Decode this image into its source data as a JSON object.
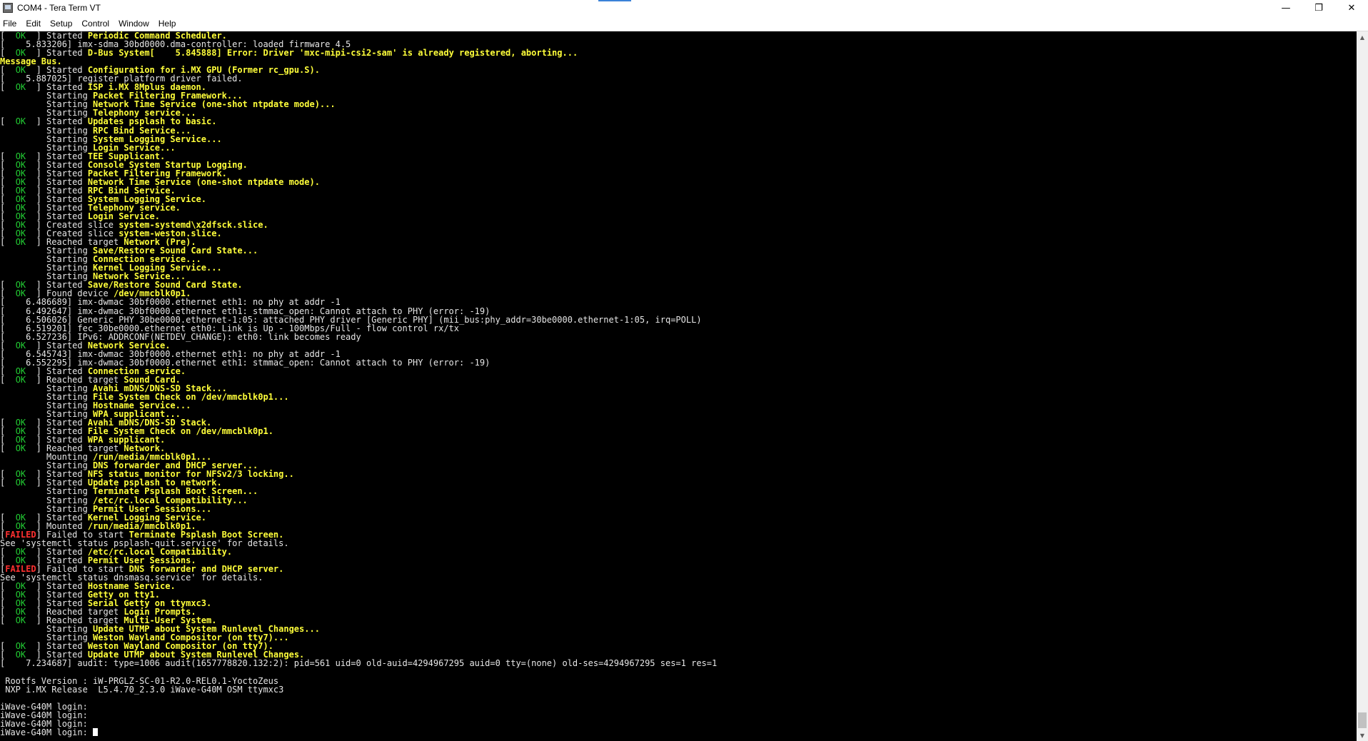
{
  "window": {
    "title": "COM4 - Tera Term VT",
    "minimize_glyph": "—",
    "restore_glyph": "❐",
    "close_glyph": "✕"
  },
  "menu": [
    "File",
    "Edit",
    "Setup",
    "Control",
    "Window",
    "Help"
  ],
  "colors": {
    "background": "#000000",
    "default": "#e6e6e6",
    "ok": "#22cc33",
    "highlight": "#ffff3a",
    "failed": "#ff3030"
  },
  "terminal": {
    "lines": [
      [
        [
          "w",
          "[  "
        ],
        [
          "g",
          "OK"
        ],
        [
          "w",
          "  ] Started "
        ],
        [
          "y",
          "Periodic Command Scheduler."
        ]
      ],
      [
        [
          "w",
          "[    5.833206] imx-sdma 30bd0000.dma-controller: loaded firmware 4.5"
        ]
      ],
      [
        [
          "w",
          "[  "
        ],
        [
          "g",
          "OK"
        ],
        [
          "w",
          "  ] Started "
        ],
        [
          "y",
          "D-Bus System[    5.845888] Error: Driver 'mxc-mipi-csi2-sam' is already registered, aborting..."
        ]
      ],
      [
        [
          "y",
          "Message Bus."
        ]
      ],
      [
        [
          "w",
          "[  "
        ],
        [
          "g",
          "OK"
        ],
        [
          "w",
          "  ] Started "
        ],
        [
          "y",
          "Configuration for i.MX GPU (Former rc_gpu.S)."
        ]
      ],
      [
        [
          "w",
          "[    5.887025] register platform driver failed."
        ]
      ],
      [
        [
          "w",
          "[  "
        ],
        [
          "g",
          "OK"
        ],
        [
          "w",
          "  ] Started "
        ],
        [
          "y",
          "ISP i.MX 8Mplus daemon."
        ]
      ],
      [
        [
          "w",
          "         Starting "
        ],
        [
          "y",
          "Packet Filtering Framework..."
        ]
      ],
      [
        [
          "w",
          "         Starting "
        ],
        [
          "y",
          "Network Time Service (one-shot ntpdate mode)..."
        ]
      ],
      [
        [
          "w",
          "         Starting "
        ],
        [
          "y",
          "Telephony service..."
        ]
      ],
      [
        [
          "w",
          "[  "
        ],
        [
          "g",
          "OK"
        ],
        [
          "w",
          "  ] Started "
        ],
        [
          "y",
          "Updates psplash to basic."
        ]
      ],
      [
        [
          "w",
          "         Starting "
        ],
        [
          "y",
          "RPC Bind Service..."
        ]
      ],
      [
        [
          "w",
          "         Starting "
        ],
        [
          "y",
          "System Logging Service..."
        ]
      ],
      [
        [
          "w",
          "         Starting "
        ],
        [
          "y",
          "Login Service..."
        ]
      ],
      [
        [
          "w",
          "[  "
        ],
        [
          "g",
          "OK"
        ],
        [
          "w",
          "  ] Started "
        ],
        [
          "y",
          "TEE Supplicant."
        ]
      ],
      [
        [
          "w",
          "[  "
        ],
        [
          "g",
          "OK"
        ],
        [
          "w",
          "  ] Started "
        ],
        [
          "y",
          "Console System Startup Logging."
        ]
      ],
      [
        [
          "w",
          "[  "
        ],
        [
          "g",
          "OK"
        ],
        [
          "w",
          "  ] Started "
        ],
        [
          "y",
          "Packet Filtering Framework."
        ]
      ],
      [
        [
          "w",
          "[  "
        ],
        [
          "g",
          "OK"
        ],
        [
          "w",
          "  ] Started "
        ],
        [
          "y",
          "Network Time Service (one-shot ntpdate mode)."
        ]
      ],
      [
        [
          "w",
          "[  "
        ],
        [
          "g",
          "OK"
        ],
        [
          "w",
          "  ] Started "
        ],
        [
          "y",
          "RPC Bind Service."
        ]
      ],
      [
        [
          "w",
          "[  "
        ],
        [
          "g",
          "OK"
        ],
        [
          "w",
          "  ] Started "
        ],
        [
          "y",
          "System Logging Service."
        ]
      ],
      [
        [
          "w",
          "[  "
        ],
        [
          "g",
          "OK"
        ],
        [
          "w",
          "  ] Started "
        ],
        [
          "y",
          "Telephony service."
        ]
      ],
      [
        [
          "w",
          "[  "
        ],
        [
          "g",
          "OK"
        ],
        [
          "w",
          "  ] Started "
        ],
        [
          "y",
          "Login Service."
        ]
      ],
      [
        [
          "w",
          "[  "
        ],
        [
          "g",
          "OK"
        ],
        [
          "w",
          "  ] Created slice "
        ],
        [
          "y",
          "system-systemd\\x2dfsck.slice."
        ]
      ],
      [
        [
          "w",
          "[  "
        ],
        [
          "g",
          "OK"
        ],
        [
          "w",
          "  ] Created slice "
        ],
        [
          "y",
          "system-weston.slice."
        ]
      ],
      [
        [
          "w",
          "[  "
        ],
        [
          "g",
          "OK"
        ],
        [
          "w",
          "  ] Reached target "
        ],
        [
          "y",
          "Network (Pre)."
        ]
      ],
      [
        [
          "w",
          "         Starting "
        ],
        [
          "y",
          "Save/Restore Sound Card State..."
        ]
      ],
      [
        [
          "w",
          "         Starting "
        ],
        [
          "y",
          "Connection service..."
        ]
      ],
      [
        [
          "w",
          "         Starting "
        ],
        [
          "y",
          "Kernel Logging Service..."
        ]
      ],
      [
        [
          "w",
          "         Starting "
        ],
        [
          "y",
          "Network Service..."
        ]
      ],
      [
        [
          "w",
          "[  "
        ],
        [
          "g",
          "OK"
        ],
        [
          "w",
          "  ] Started "
        ],
        [
          "y",
          "Save/Restore Sound Card State."
        ]
      ],
      [
        [
          "w",
          "[  "
        ],
        [
          "g",
          "OK"
        ],
        [
          "w",
          "  ] Found device "
        ],
        [
          "y",
          "/dev/mmcblk0p1."
        ]
      ],
      [
        [
          "w",
          "[    6.486689] imx-dwmac 30bf0000.ethernet eth1: no phy at addr -1"
        ]
      ],
      [
        [
          "w",
          "[    6.492647] imx-dwmac 30bf0000.ethernet eth1: stmmac_open: Cannot attach to PHY (error: -19)"
        ]
      ],
      [
        [
          "w",
          "[    6.506026] Generic PHY 30be0000.ethernet-1:05: attached PHY driver [Generic PHY] (mii_bus:phy_addr=30be0000.ethernet-1:05, irq=POLL)"
        ]
      ],
      [
        [
          "w",
          "[    6.519201] fec 30be0000.ethernet eth0: Link is Up - 100Mbps/Full - flow control rx/tx"
        ]
      ],
      [
        [
          "w",
          "[    6.527236] IPv6: ADDRCONF(NETDEV_CHANGE): eth0: link becomes ready"
        ]
      ],
      [
        [
          "w",
          "[  "
        ],
        [
          "g",
          "OK"
        ],
        [
          "w",
          "  ] Started "
        ],
        [
          "y",
          "Network Service."
        ]
      ],
      [
        [
          "w",
          "[    6.545743] imx-dwmac 30bf0000.ethernet eth1: no phy at addr -1"
        ]
      ],
      [
        [
          "w",
          "[    6.552295] imx-dwmac 30bf0000.ethernet eth1: stmmac_open: Cannot attach to PHY (error: -19)"
        ]
      ],
      [
        [
          "w",
          "[  "
        ],
        [
          "g",
          "OK"
        ],
        [
          "w",
          "  ] Started "
        ],
        [
          "y",
          "Connection service."
        ]
      ],
      [
        [
          "w",
          "[  "
        ],
        [
          "g",
          "OK"
        ],
        [
          "w",
          "  ] Reached target "
        ],
        [
          "y",
          "Sound Card."
        ]
      ],
      [
        [
          "w",
          "         Starting "
        ],
        [
          "y",
          "Avahi mDNS/DNS-SD Stack..."
        ]
      ],
      [
        [
          "w",
          "         Starting "
        ],
        [
          "y",
          "File System Check on /dev/mmcblk0p1..."
        ]
      ],
      [
        [
          "w",
          "         Starting "
        ],
        [
          "y",
          "Hostname Service..."
        ]
      ],
      [
        [
          "w",
          "         Starting "
        ],
        [
          "y",
          "WPA supplicant..."
        ]
      ],
      [
        [
          "w",
          "[  "
        ],
        [
          "g",
          "OK"
        ],
        [
          "w",
          "  ] Started "
        ],
        [
          "y",
          "Avahi mDNS/DNS-SD Stack."
        ]
      ],
      [
        [
          "w",
          "[  "
        ],
        [
          "g",
          "OK"
        ],
        [
          "w",
          "  ] Started "
        ],
        [
          "y",
          "File System Check on /dev/mmcblk0p1."
        ]
      ],
      [
        [
          "w",
          "[  "
        ],
        [
          "g",
          "OK"
        ],
        [
          "w",
          "  ] Started "
        ],
        [
          "y",
          "WPA supplicant."
        ]
      ],
      [
        [
          "w",
          "[  "
        ],
        [
          "g",
          "OK"
        ],
        [
          "w",
          "  ] Reached target "
        ],
        [
          "y",
          "Network."
        ]
      ],
      [
        [
          "w",
          "         Mounting "
        ],
        [
          "y",
          "/run/media/mmcblk0p1..."
        ]
      ],
      [
        [
          "w",
          "         Starting "
        ],
        [
          "y",
          "DNS forwarder and DHCP server..."
        ]
      ],
      [
        [
          "w",
          "[  "
        ],
        [
          "g",
          "OK"
        ],
        [
          "w",
          "  ] Started "
        ],
        [
          "y",
          "NFS status monitor for NFSv2/3 locking.."
        ]
      ],
      [
        [
          "w",
          "[  "
        ],
        [
          "g",
          "OK"
        ],
        [
          "w",
          "  ] Started "
        ],
        [
          "y",
          "Update psplash to network."
        ]
      ],
      [
        [
          "w",
          "         Starting "
        ],
        [
          "y",
          "Terminate Psplash Boot Screen..."
        ]
      ],
      [
        [
          "w",
          "         Starting "
        ],
        [
          "y",
          "/etc/rc.local Compatibility..."
        ]
      ],
      [
        [
          "w",
          "         Starting "
        ],
        [
          "y",
          "Permit User Sessions..."
        ]
      ],
      [
        [
          "w",
          "[  "
        ],
        [
          "g",
          "OK"
        ],
        [
          "w",
          "  ] Started "
        ],
        [
          "y",
          "Kernel Logging Service."
        ]
      ],
      [
        [
          "w",
          "[  "
        ],
        [
          "g",
          "OK"
        ],
        [
          "w",
          "  ] Mounted "
        ],
        [
          "y",
          "/run/media/mmcblk0p1."
        ]
      ],
      [
        [
          "w",
          "["
        ],
        [
          "r",
          "FAILED"
        ],
        [
          "w",
          "] Failed to start "
        ],
        [
          "y",
          "Terminate Psplash Boot Screen."
        ]
      ],
      [
        [
          "w",
          "See 'systemctl status psplash-quit.service' for details."
        ]
      ],
      [
        [
          "w",
          "[  "
        ],
        [
          "g",
          "OK"
        ],
        [
          "w",
          "  ] Started "
        ],
        [
          "y",
          "/etc/rc.local Compatibility."
        ]
      ],
      [
        [
          "w",
          "[  "
        ],
        [
          "g",
          "OK"
        ],
        [
          "w",
          "  ] Started "
        ],
        [
          "y",
          "Permit User Sessions."
        ]
      ],
      [
        [
          "w",
          "["
        ],
        [
          "r",
          "FAILED"
        ],
        [
          "w",
          "] Failed to start "
        ],
        [
          "y",
          "DNS forwarder and DHCP server."
        ]
      ],
      [
        [
          "w",
          "See 'systemctl status dnsmasq.service' for details."
        ]
      ],
      [
        [
          "w",
          "[  "
        ],
        [
          "g",
          "OK"
        ],
        [
          "w",
          "  ] Started "
        ],
        [
          "y",
          "Hostname Service."
        ]
      ],
      [
        [
          "w",
          "[  "
        ],
        [
          "g",
          "OK"
        ],
        [
          "w",
          "  ] Started "
        ],
        [
          "y",
          "Getty on tty1."
        ]
      ],
      [
        [
          "w",
          "[  "
        ],
        [
          "g",
          "OK"
        ],
        [
          "w",
          "  ] Started "
        ],
        [
          "y",
          "Serial Getty on ttymxc3."
        ]
      ],
      [
        [
          "w",
          "[  "
        ],
        [
          "g",
          "OK"
        ],
        [
          "w",
          "  ] Reached target "
        ],
        [
          "y",
          "Login Prompts."
        ]
      ],
      [
        [
          "w",
          "[  "
        ],
        [
          "g",
          "OK"
        ],
        [
          "w",
          "  ] Reached target "
        ],
        [
          "y",
          "Multi-User System."
        ]
      ],
      [
        [
          "w",
          "         Starting "
        ],
        [
          "y",
          "Update UTMP about System Runlevel Changes..."
        ]
      ],
      [
        [
          "w",
          "         Starting "
        ],
        [
          "y",
          "Weston Wayland Compositor (on tty7)..."
        ]
      ],
      [
        [
          "w",
          "[  "
        ],
        [
          "g",
          "OK"
        ],
        [
          "w",
          "  ] Started "
        ],
        [
          "y",
          "Weston Wayland Compositor (on tty7)."
        ]
      ],
      [
        [
          "w",
          "[  "
        ],
        [
          "g",
          "OK"
        ],
        [
          "w",
          "  ] Started "
        ],
        [
          "y",
          "Update UTMP about System Runlevel Changes."
        ]
      ],
      [
        [
          "w",
          "[    7.234687] audit: type=1006 audit(1657778820.132:2): pid=561 uid=0 old-auid=4294967295 auid=0 tty=(none) old-ses=4294967295 ses=1 res=1"
        ]
      ],
      [
        [
          "w",
          ""
        ]
      ],
      [
        [
          "w",
          " Rootfs Version : iW-PRGLZ-SC-01-R2.0-REL0.1-YoctoZeus"
        ]
      ],
      [
        [
          "w",
          " NXP i.MX Release  L5.4.70_2.3.0 iWave-G40M OSM ttymxc3"
        ]
      ],
      [
        [
          "w",
          ""
        ]
      ],
      [
        [
          "w",
          "iWave-G40M login:"
        ]
      ],
      [
        [
          "w",
          "iWave-G40M login:"
        ]
      ],
      [
        [
          "w",
          "iWave-G40M login:"
        ]
      ],
      [
        [
          "w",
          "iWave-G40M login: "
        ],
        [
          "cursor",
          ""
        ]
      ]
    ]
  }
}
